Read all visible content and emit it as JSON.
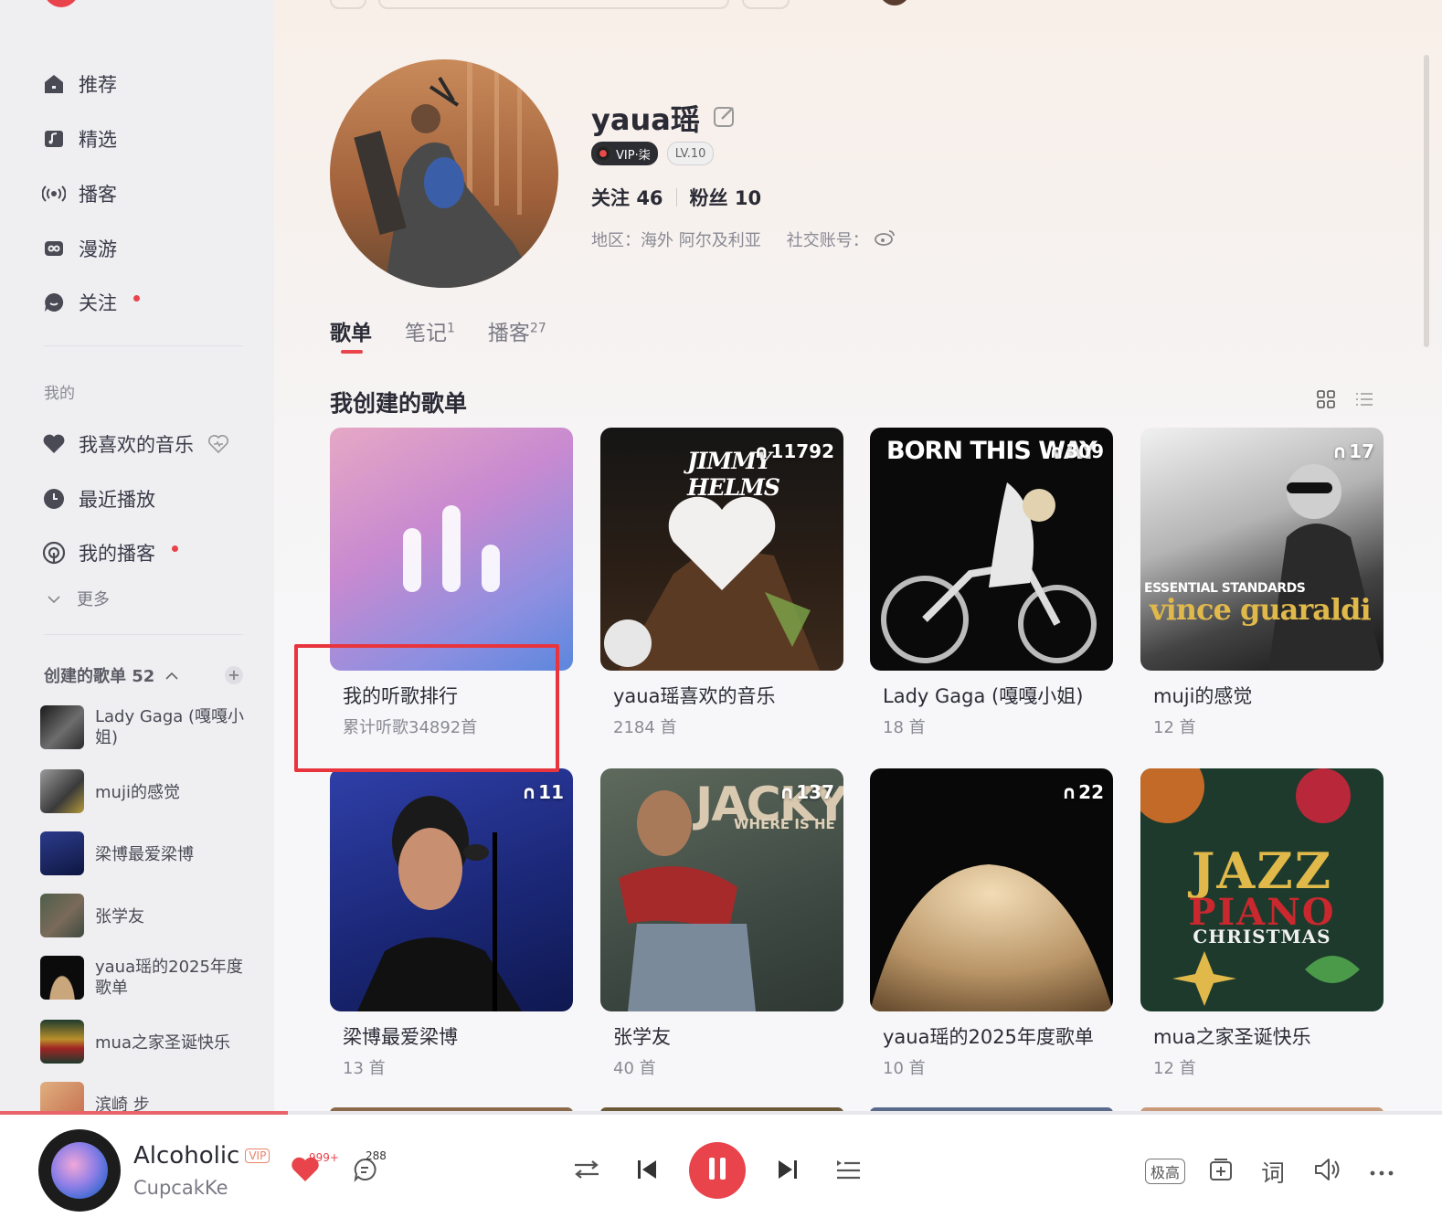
{
  "sidebar": {
    "nav": [
      {
        "label": "推荐",
        "icon": "home-icon"
      },
      {
        "label": "精选",
        "icon": "music-note-icon"
      },
      {
        "label": "播客",
        "icon": "broadcast-icon"
      },
      {
        "label": "漫游",
        "icon": "roam-icon"
      },
      {
        "label": "关注",
        "icon": "chat-icon",
        "dot": true
      }
    ],
    "my_section": "我的",
    "my_items": [
      {
        "label": "我喜欢的音乐",
        "icon": "heart-icon"
      },
      {
        "label": "最近播放",
        "icon": "clock-icon"
      },
      {
        "label": "我的播客",
        "icon": "podcast-icon",
        "dot": true
      }
    ],
    "more": "更多",
    "created_header": "创建的歌单 52",
    "created_playlists": [
      {
        "label": "Lady Gaga (嘎嘎小姐)"
      },
      {
        "label": "muji的感觉"
      },
      {
        "label": "梁博最爱梁博"
      },
      {
        "label": "张学友"
      },
      {
        "label": "yaua瑶的2025年度歌单"
      },
      {
        "label": "mua之家圣诞快乐"
      },
      {
        "label": "滨崎 步"
      }
    ]
  },
  "profile": {
    "username": "yaua瑶",
    "vip": "VIP·柒",
    "level": "LV.10",
    "follow_label": "关注",
    "follow_count": "46",
    "fans_label": "粉丝",
    "fans_count": "10",
    "region": "地区：海外 阿尔及利亚",
    "social": "社交账号："
  },
  "tabs": [
    {
      "label": "歌单",
      "count": ""
    },
    {
      "label": "笔记",
      "count": "1"
    },
    {
      "label": "播客",
      "count": "27"
    }
  ],
  "section_title": "我创建的歌单",
  "playlists": [
    {
      "title": "我的听歌排行",
      "sub": "累计听歌34892首",
      "plays": ""
    },
    {
      "title": "yaua瑶喜欢的音乐",
      "sub": "2184 首",
      "plays": "11792"
    },
    {
      "title": "Lady Gaga (嘎嘎小姐)",
      "sub": "18 首",
      "plays": "309"
    },
    {
      "title": "muji的感觉",
      "sub": "12 首",
      "plays": "17"
    },
    {
      "title": "梁博最爱梁博",
      "sub": "13 首",
      "plays": "11"
    },
    {
      "title": "张学友",
      "sub": "40 首",
      "plays": "137"
    },
    {
      "title": "yaua瑶的2025年度歌单",
      "sub": "10 首",
      "plays": "22"
    },
    {
      "title": "mua之家圣诞快乐",
      "sub": "12 首",
      "plays": ""
    }
  ],
  "cover_text": {
    "jimmy": "JIMMY HELMS",
    "gaga": "BORN THIS WAY",
    "vince_small": "ESSENTIAL STANDARDS",
    "vince": "vince guaraldi",
    "jacky": "JACKY",
    "jacky_sub": "WHERE IS HE",
    "jazz": "JAZZ",
    "piano": "PIANO",
    "christmas": "CHRISTMAS"
  },
  "player": {
    "title": "Alcoholic",
    "vip": "VIP",
    "artist": "CupcakKe",
    "like_count": "999+",
    "comment_count": "288",
    "quality": "极高",
    "lyrics": "词"
  },
  "colors": {
    "accent": "#e9434b"
  }
}
